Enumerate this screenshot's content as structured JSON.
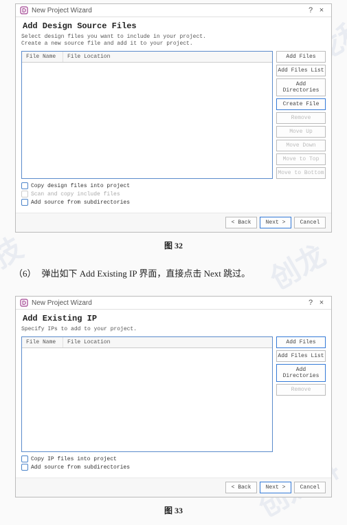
{
  "dialog1": {
    "titlebar": {
      "title": "New Project Wizard",
      "help": "?",
      "close": "×"
    },
    "heading": "Add Design Source Files",
    "subtext1": "Select design files you want to include in your project.",
    "subtext2": "Create a new source file and add it to your project.",
    "columns": {
      "name": "File Name",
      "location": "File Location"
    },
    "buttons": {
      "add_files": "Add Files",
      "add_list": "Add Files List",
      "add_dirs": "Add Directories",
      "create": "Create File",
      "remove": "Remove",
      "move_up": "Move Up",
      "move_down": "Move Down",
      "move_top": "Move to Top",
      "move_bottom": "Move to Bottom"
    },
    "checks": {
      "copy": "Copy design files into project",
      "scan": "Scan and copy include files",
      "sub": "Add source from subdirectories"
    },
    "footer": {
      "back": "< Back",
      "next": "Next >",
      "cancel": "Cancel"
    }
  },
  "caption1": "图 32",
  "step": {
    "no": "（6）",
    "text": "弹出如下 Add Existing IP 界面，直接点击 Next 跳过。"
  },
  "dialog2": {
    "titlebar": {
      "title": "New Project Wizard",
      "help": "?",
      "close": "×"
    },
    "heading": "Add Existing IP",
    "subtext1": "Specify IPs to add to your project.",
    "columns": {
      "name": "File Name",
      "location": "File Location"
    },
    "buttons": {
      "add_files": "Add Files",
      "add_list": "Add Files List",
      "add_dirs": "Add Directories",
      "remove": "Remove"
    },
    "checks": {
      "copy": "Copy IP files into project",
      "sub": "Add source from subdirectories"
    },
    "footer": {
      "back": "< Back",
      "next": "Next >",
      "cancel": "Cancel"
    }
  },
  "caption2": "图 33"
}
